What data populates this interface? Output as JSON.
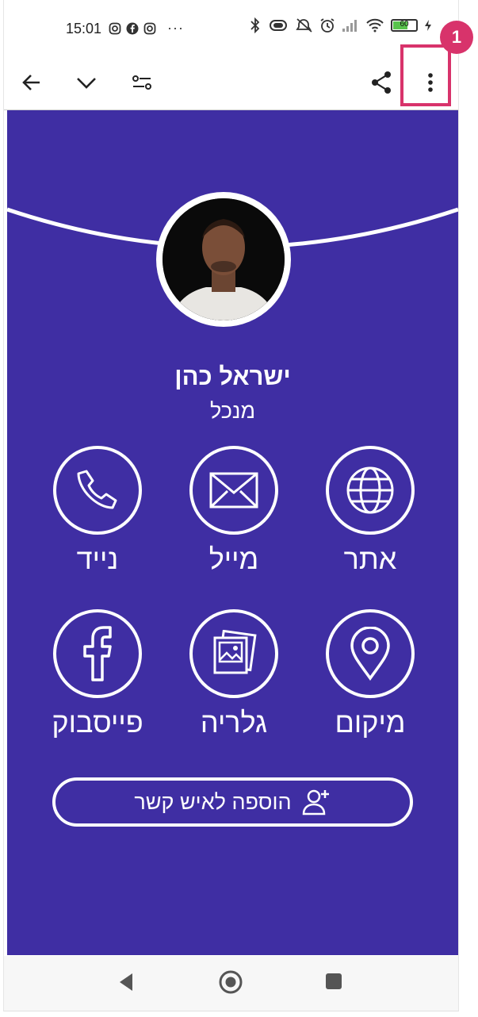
{
  "status_bar": {
    "time": "15:01",
    "more": "···",
    "battery": "60",
    "icons_left": [
      "instagram-icon",
      "facebook-icon",
      "instagram-icon"
    ],
    "icons_right": [
      "bluetooth-icon",
      "vibrate-icon",
      "mute-icon",
      "alarm-icon",
      "signal-icon",
      "wifi-icon",
      "battery-icon",
      "charging-icon"
    ]
  },
  "app_bar": {
    "back": "back-arrow-icon",
    "collapse": "chevron-down-icon",
    "filters": "tune-icon",
    "share": "share-icon",
    "menu": "more-vert-icon"
  },
  "callout": {
    "number": "1",
    "color": "#d8336b"
  },
  "card": {
    "background": "#3f2ea3",
    "name": "ישראל כהן",
    "role": "מנכל",
    "actions": [
      {
        "label": "אתר",
        "icon": "globe-icon"
      },
      {
        "label": "מייל",
        "icon": "envelope-icon"
      },
      {
        "label": "נייד",
        "icon": "phone-icon"
      },
      {
        "label": "מיקום",
        "icon": "location-pin-icon"
      },
      {
        "label": "גלריה",
        "icon": "gallery-icon"
      },
      {
        "label": "פייסבוק",
        "icon": "facebook-icon"
      }
    ],
    "add_contact": "הוספה לאיש קשר"
  },
  "nav_bar": {
    "back": "nav-back-icon",
    "home": "nav-home-icon",
    "recents": "nav-recents-icon"
  }
}
